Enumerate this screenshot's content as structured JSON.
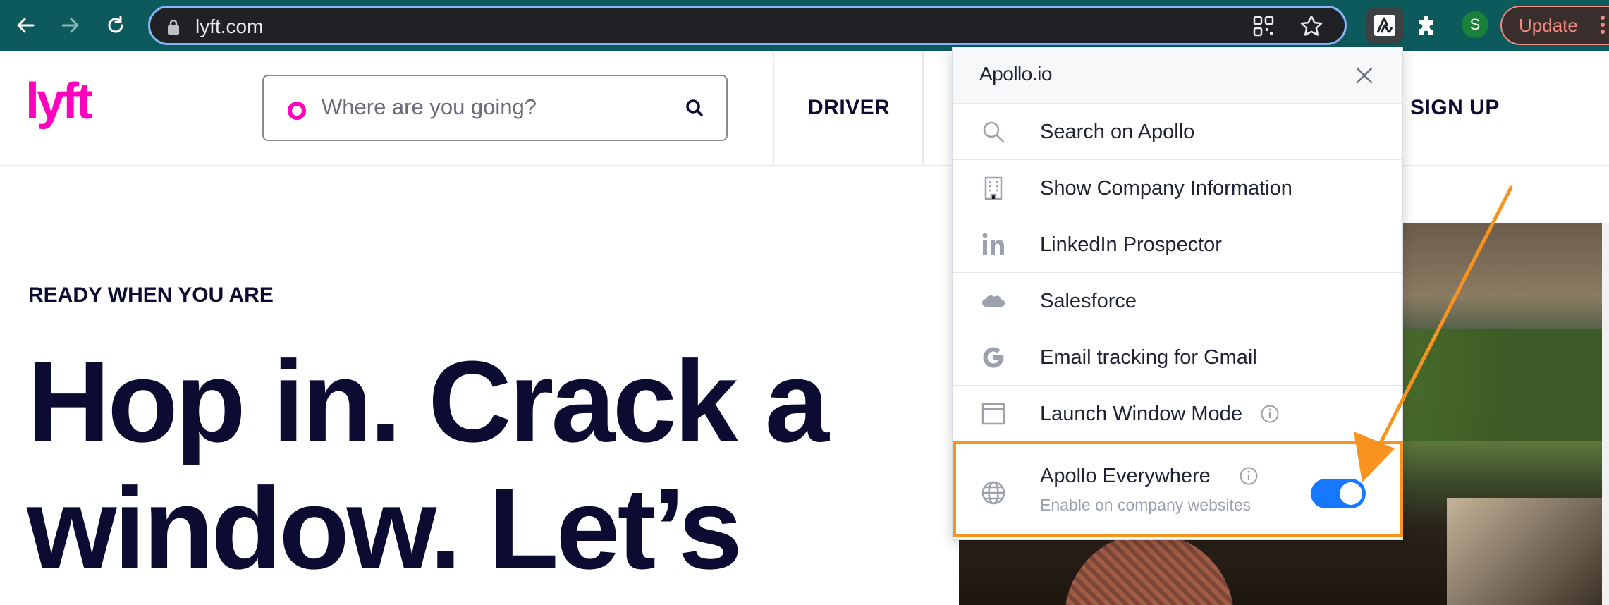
{
  "browser": {
    "url": "lyft.com",
    "profile_initial": "S",
    "update_label": "Update",
    "icons": [
      "back-icon",
      "forward-icon",
      "reload-icon",
      "lock-icon",
      "qr-code-icon",
      "star-icon",
      "apollo-extension-icon",
      "puzzle-icon"
    ]
  },
  "site": {
    "logo": "lyft",
    "search_placeholder": "Where are you going?",
    "nav": {
      "driver": "DRIVER",
      "signup": "SIGN UP"
    },
    "eyebrow": "READY WHEN YOU ARE",
    "hero_lines": [
      "Hop in. Crack a",
      "window. Let’s"
    ],
    "brand_color": "#ff00bf",
    "text_color": "#0c0b31"
  },
  "apollo_popup": {
    "logo": "Apollo.io",
    "items": [
      {
        "label": "Search on Apollo",
        "icon": "search-icon"
      },
      {
        "label": "Show Company Information",
        "icon": "building-icon"
      },
      {
        "label": "LinkedIn Prospector",
        "icon": "linkedin-icon"
      },
      {
        "label": "Salesforce",
        "icon": "salesforce-cloud-icon"
      },
      {
        "label": "Email tracking for Gmail",
        "icon": "google-icon"
      },
      {
        "label": "Launch Window Mode",
        "icon": "window-icon"
      }
    ],
    "everywhere": {
      "title": "Apollo Everywhere",
      "subtitle": "Enable on company websites",
      "icon": "globe-icon",
      "enabled": true
    },
    "toggle_color": "#1677ff",
    "highlight_color": "#f7931e"
  }
}
